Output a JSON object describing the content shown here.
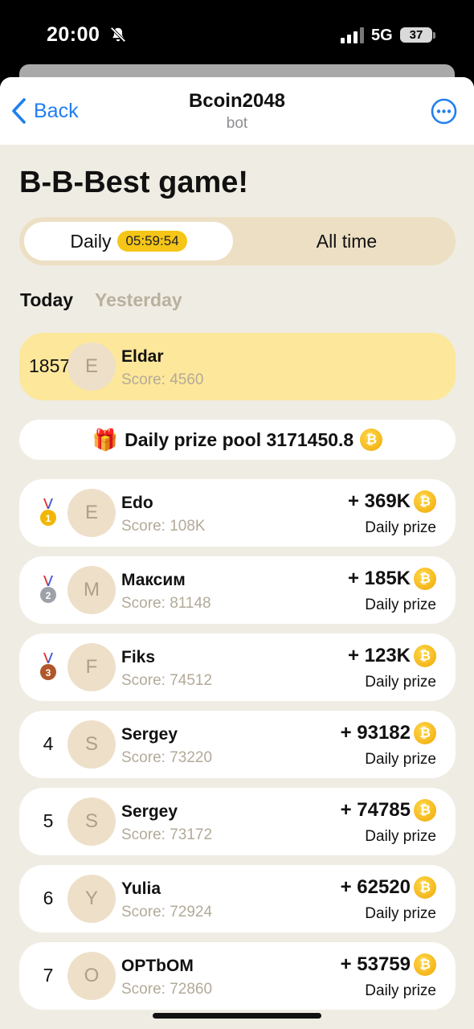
{
  "status_bar": {
    "time": "20:00",
    "network": "5G",
    "battery": "37"
  },
  "nav": {
    "back_label": "Back",
    "title": "Bcoin2048",
    "subtitle": "bot"
  },
  "page_title": "B-B-Best game!",
  "segment": {
    "daily_label": "Daily",
    "timer": "05:59:54",
    "all_time_label": "All time"
  },
  "day_tabs": {
    "today": "Today",
    "yesterday": "Yesterday"
  },
  "current_user": {
    "rank": "1857",
    "initial": "E",
    "name": "Eldar",
    "score": "Score: 4560"
  },
  "prize_pool": {
    "icon": "gift-icon",
    "text": "Daily prize pool 3171450.8",
    "coin_symbol": "₿"
  },
  "coin_symbol": "₿",
  "colors": {
    "accent": "#1f7ff0",
    "highlight": "#fde79a",
    "timer": "#f5c518",
    "coin": "#f0a808",
    "background": "#efece3"
  },
  "leaderboard": [
    {
      "rank": "1",
      "medal": "gold",
      "initial": "E",
      "name": "Edo",
      "score": "Score: 108K",
      "prize": "+ 369K",
      "prize_label": "Daily prize"
    },
    {
      "rank": "2",
      "medal": "silver",
      "initial": "M",
      "name": "Максим",
      "score": "Score: 81148",
      "prize": "+ 185K",
      "prize_label": "Daily prize"
    },
    {
      "rank": "3",
      "medal": "bronze",
      "initial": "F",
      "name": "Fiks",
      "score": "Score: 74512",
      "prize": "+ 123K",
      "prize_label": "Daily prize"
    },
    {
      "rank": "4",
      "initial": "S",
      "name": "Sergey",
      "score": "Score: 73220",
      "prize": "+ 93182",
      "prize_label": "Daily prize"
    },
    {
      "rank": "5",
      "initial": "S",
      "name": "Sergey",
      "score": "Score: 73172",
      "prize": "+ 74785",
      "prize_label": "Daily prize"
    },
    {
      "rank": "6",
      "initial": "Y",
      "name": "Yulia",
      "score": "Score: 72924",
      "prize": "+ 62520",
      "prize_label": "Daily prize"
    },
    {
      "rank": "7",
      "initial": "O",
      "name": "OPTbOM",
      "score": "Score: 72860",
      "prize": "+ 53759",
      "prize_label": "Daily prize"
    }
  ]
}
